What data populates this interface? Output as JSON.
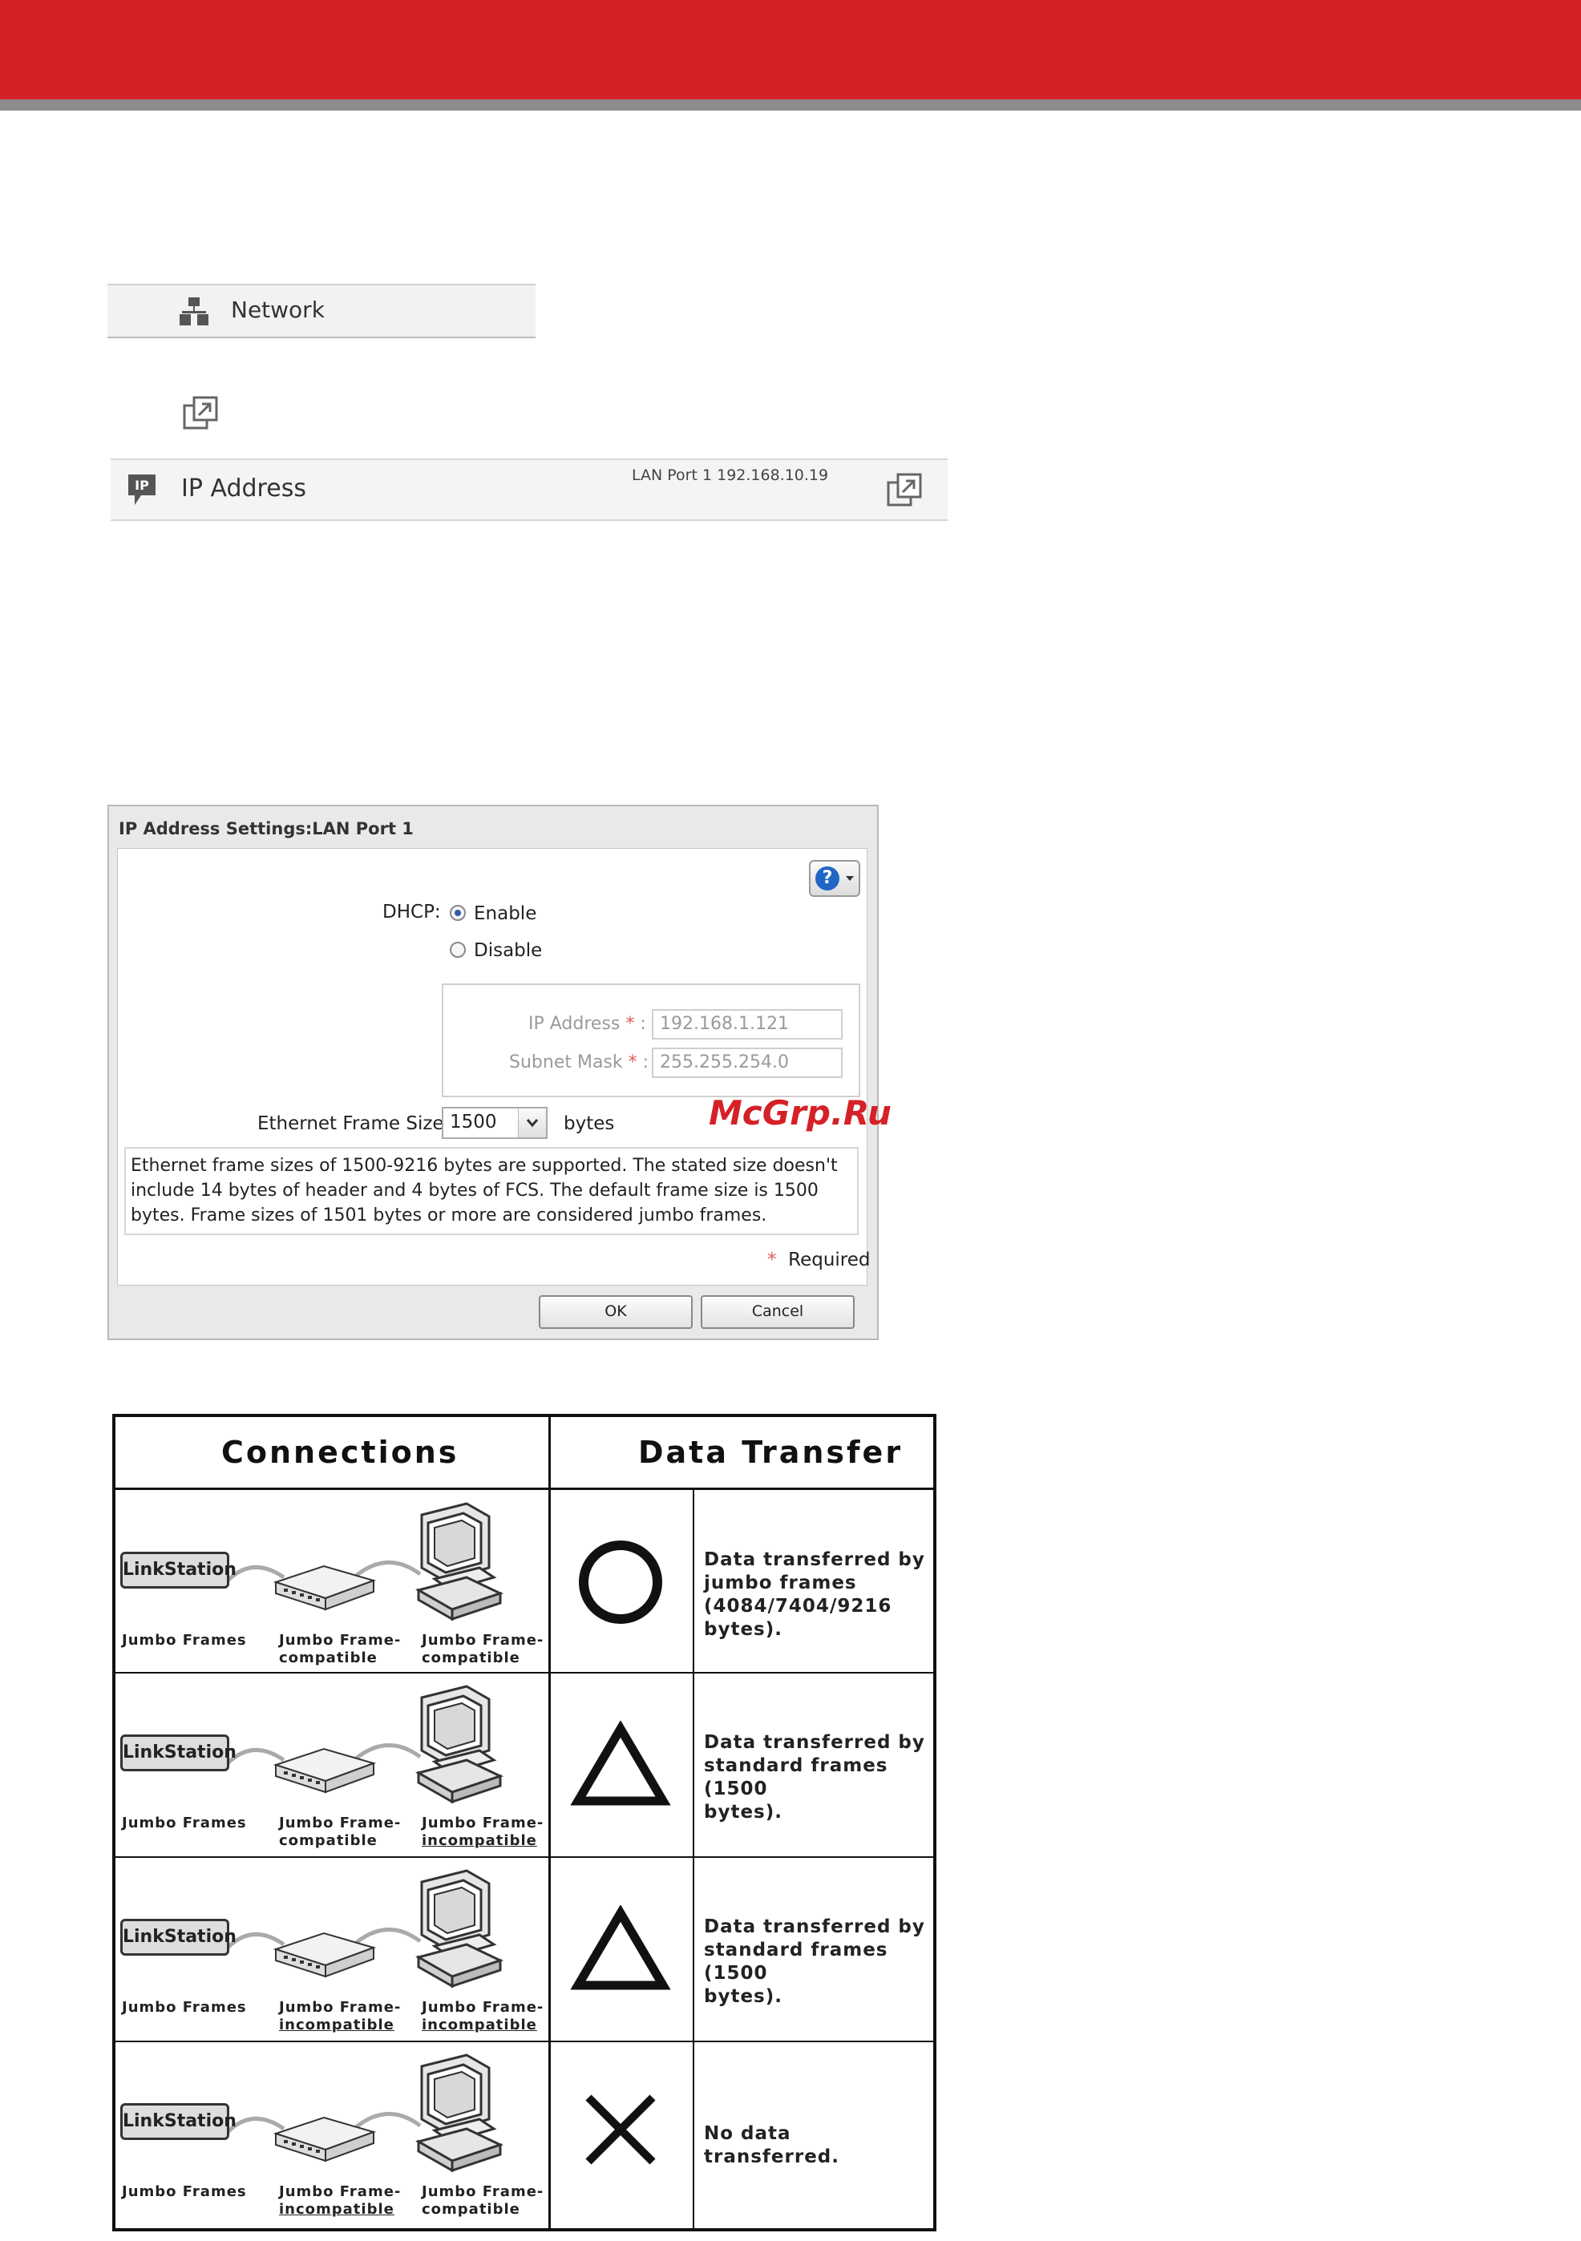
{
  "network_menu": {
    "label": "Network",
    "icon": "network-icon"
  },
  "ip_row": {
    "label": "IP Address",
    "value": "LAN Port 1 192.168.10.19",
    "icon": "ip-address-icon",
    "action_icon": "expand-icon"
  },
  "dialog": {
    "title": "IP Address Settings:LAN Port 1",
    "dhcp_label": "DHCP:",
    "dhcp_options": [
      "Enable",
      "Disable"
    ],
    "dhcp_selected": "Enable",
    "ip_label": "IP Address",
    "ip_value": "192.168.1.121",
    "mask_label": "Subnet Mask",
    "mask_value": "255.255.254.0",
    "required_mark": "*",
    "colon": ":",
    "frame_label": "Ethernet Frame Size:",
    "frame_value": "1500",
    "frame_unit": "bytes",
    "note": "Ethernet frame sizes of 1500-9216 bytes are supported. The stated size doesn't include 14 bytes of header and 4 bytes of FCS. The default frame size is 1500 bytes. Frame sizes of 1501 bytes or more are considered jumbo frames.",
    "required_text": "Required",
    "ok": "OK",
    "cancel": "Cancel",
    "help_glyph": "?"
  },
  "watermark": "McGrp.Ru",
  "table": {
    "headers": [
      "Connections",
      "Data Transfer"
    ],
    "device_label": "LinkStation",
    "rows": [
      {
        "ls": "Jumbo Frames",
        "hub_1": "Jumbo Frame-",
        "hub_2": "compatible",
        "pc_1": "Jumbo Frame-",
        "pc_2": "compatible",
        "symbol": "circle",
        "desc_1": "Data transferred by",
        "desc_2": "jumbo frames",
        "desc_3": "(4084/7404/9216 bytes)."
      },
      {
        "ls": "Jumbo Frames",
        "hub_1": "Jumbo Frame-",
        "hub_2": "compatible",
        "pc_1": "Jumbo Frame-",
        "pc_2": "incompatible",
        "symbol": "triangle",
        "desc_1": "Data transferred by",
        "desc_2": "standard frames (1500",
        "desc_3": "bytes)."
      },
      {
        "ls": "Jumbo Frames",
        "hub_1": "Jumbo Frame-",
        "hub_2": "incompatible",
        "pc_1": "Jumbo Frame-",
        "pc_2": "incompatible",
        "symbol": "triangle",
        "desc_1": "Data transferred by",
        "desc_2": "standard frames (1500",
        "desc_3": "bytes)."
      },
      {
        "ls": "Jumbo Frames",
        "hub_1": "Jumbo Frame-",
        "hub_2": "incompatible",
        "pc_1": "Jumbo Frame-",
        "pc_2": "compatible",
        "symbol": "cross",
        "desc_1": "No data transferred.",
        "desc_2": "",
        "desc_3": ""
      }
    ]
  },
  "colors": {
    "brand_red": "#d42127",
    "band_gray": "#8c8c8c",
    "help_blue": "#1f66c5"
  }
}
